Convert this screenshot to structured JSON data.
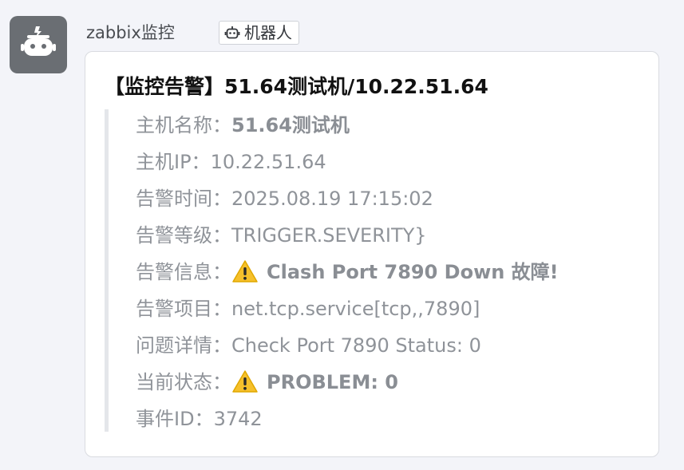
{
  "sender": {
    "avatar_icon": "robot-icon",
    "name": "zabbix监控",
    "badge_icon": "robot-icon",
    "badge_label": "机器人"
  },
  "message": {
    "title": "【监控告警】51.64测试机/10.22.51.64",
    "rows": [
      {
        "label": "主机名称：",
        "value": "51.64测试机",
        "bold": true,
        "icon": ""
      },
      {
        "label": "主机IP：",
        "value": "10.22.51.64",
        "bold": false,
        "icon": ""
      },
      {
        "label": "告警时间：",
        "value": "2025.08.19 17:15:02",
        "bold": false,
        "icon": ""
      },
      {
        "label": "告警等级：",
        "value": "TRIGGER.SEVERITY}",
        "bold": false,
        "icon": ""
      },
      {
        "label": "告警信息：",
        "value": "Clash Port 7890 Down 故障!",
        "bold": true,
        "icon": "warning-icon"
      },
      {
        "label": "告警项目：",
        "value": "net.tcp.service[tcp,,7890]",
        "bold": false,
        "icon": ""
      },
      {
        "label": "问题详情：",
        "value": "Check Port 7890 Status: 0",
        "bold": false,
        "icon": ""
      },
      {
        "label": "当前状态：",
        "value": "PROBLEM: 0",
        "bold": true,
        "icon": "warning-icon"
      },
      {
        "label": "事件ID：",
        "value": "3742",
        "bold": false,
        "icon": ""
      }
    ]
  },
  "colors": {
    "background": "#f3f4f9",
    "avatar": "#6a6e73",
    "card": "#ffffff",
    "muted_text": "#8f9399",
    "warning_yellow": "#f6c02b"
  }
}
